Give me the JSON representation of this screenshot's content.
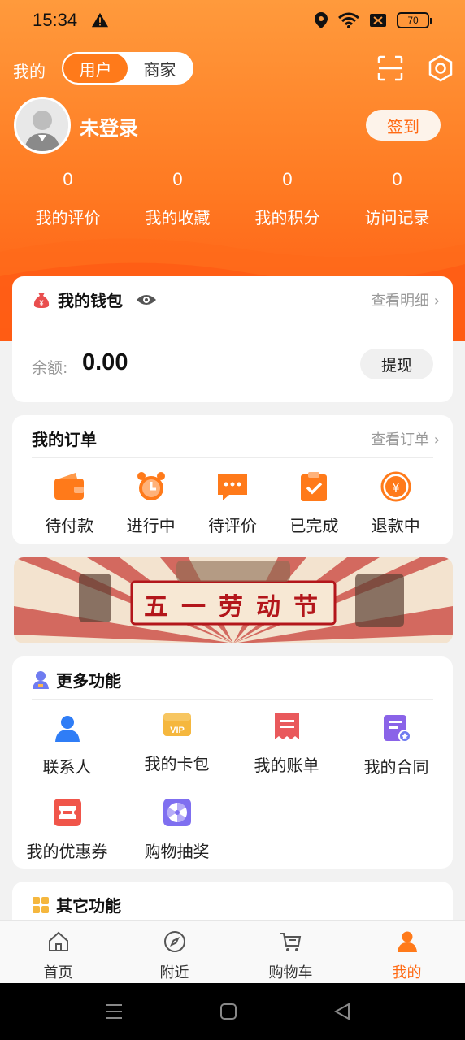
{
  "status": {
    "time": "15:34",
    "battery": "70"
  },
  "header": {
    "me_label": "我的",
    "toggle": [
      "用户",
      "商家"
    ],
    "active_toggle": 0
  },
  "profile": {
    "name": "未登录",
    "signin": "签到"
  },
  "stats": [
    {
      "value": "0",
      "label": "我的评价"
    },
    {
      "value": "0",
      "label": "我的收藏"
    },
    {
      "value": "0",
      "label": "我的积分"
    },
    {
      "value": "0",
      "label": "访问记录"
    }
  ],
  "wallet": {
    "title": "我的钱包",
    "detail": "查看明细",
    "balance_label": "余额:",
    "balance": "0.00",
    "withdraw": "提现"
  },
  "orders": {
    "title": "我的订单",
    "view_all": "查看订单",
    "items": [
      {
        "label": "待付款",
        "icon": "wallet-icon"
      },
      {
        "label": "进行中",
        "icon": "alarm-clock-icon"
      },
      {
        "label": "待评价",
        "icon": "chat-bubble-icon"
      },
      {
        "label": "已完成",
        "icon": "clipboard-check-icon"
      },
      {
        "label": "退款中",
        "icon": "yen-refund-icon"
      }
    ]
  },
  "banner": {
    "text": "五一劳动节"
  },
  "more_functions": {
    "title": "更多功能",
    "items": [
      {
        "label": "联系人",
        "icon": "contact-person-icon"
      },
      {
        "label": "我的卡包",
        "icon": "vip-card-icon",
        "badge": "VIP"
      },
      {
        "label": "我的账单",
        "icon": "bill-icon"
      },
      {
        "label": "我的合同",
        "icon": "contract-icon"
      },
      {
        "label": "我的优惠券",
        "icon": "coupon-icon"
      },
      {
        "label": "购物抽奖",
        "icon": "lottery-wheel-icon"
      }
    ]
  },
  "other_functions": {
    "title": "其它功能"
  },
  "tabbar": {
    "items": [
      {
        "label": "首页",
        "icon": "home-icon"
      },
      {
        "label": "附近",
        "icon": "compass-icon"
      },
      {
        "label": "购物车",
        "icon": "cart-icon"
      },
      {
        "label": "我的",
        "icon": "person-icon"
      }
    ],
    "active": 3
  },
  "colors": {
    "accent": "#ff7a1a",
    "hero_top": "#ff9a3c",
    "hero_bottom": "#ff5a14",
    "text": "#222222",
    "muted": "#999999"
  }
}
